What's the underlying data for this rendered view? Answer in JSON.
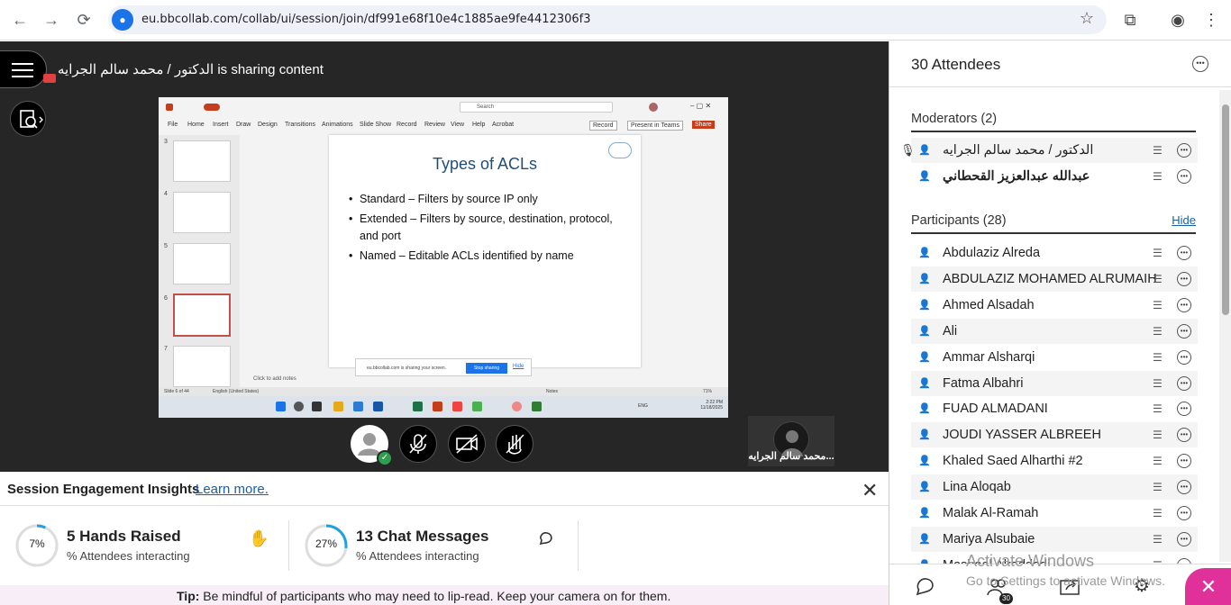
{
  "browser": {
    "url": "eu.bbcollab.com/collab/ui/session/join/df991e68f10e4c1885ae9fe4412306f3"
  },
  "stage": {
    "sharing_notice": "الدكتور / محمد سالم الجرايه is sharing content",
    "shared_slide": {
      "title": "Types of ACLs",
      "bullets": [
        "Standard – Filters by source IP only",
        "Extended – Filters by source, destination, protocol, and port",
        "Named – Editable ACLs identified by name"
      ],
      "search_placeholder": "Search",
      "ribbon_tabs": [
        "File",
        "Home",
        "Insert",
        "Draw",
        "Design",
        "Transitions",
        "Animations",
        "Slide Show",
        "Record",
        "Review",
        "View",
        "Help",
        "Acrobat"
      ],
      "record_label": "Record",
      "present_label": "Present in Teams",
      "share_label": "Share",
      "thumb_numbers": [
        "3",
        "4",
        "5",
        "6",
        "7"
      ],
      "notes_placeholder": "Click to add notes",
      "status_slide": "Slide 6 of 44",
      "status_lang": "English (United States)",
      "status_notes": "Notes",
      "zoom": "71%",
      "sharing_bar_text": "eu.bbcollab.com is sharing your screen.",
      "stop_sharing": "Stop sharing",
      "hide": "Hide",
      "clock_time": "2:22 PM",
      "clock_date": "11/18/2025",
      "lang_indicator": "ENG"
    },
    "video_tile_name": "محمد سالم الجرايه..."
  },
  "insights": {
    "title": "Session Engagement Insights",
    "learn_more": "Learn more.",
    "hands": {
      "percent_label": "7%",
      "percent": 7,
      "value": "5 Hands Raised",
      "sub": "% Attendees interacting"
    },
    "chat": {
      "percent_label": "27%",
      "percent": 27,
      "value": "13 Chat Messages",
      "sub": "% Attendees interacting"
    },
    "tip_label": "Tip:",
    "tip_text": "Be mindful of participants who may need to lip-read. Keep your camera on for them."
  },
  "attendees": {
    "title": "30 Attendees",
    "moderators_heading": "Moderators (2)",
    "moderators": [
      {
        "name": "الدكتور / محمد سالم الجرايه",
        "bold": false
      },
      {
        "name": "عبدالله عبدالعزيز القحطاني",
        "bold": true
      }
    ],
    "participants_heading": "Participants (28)",
    "hide_label": "Hide",
    "participants": [
      "Abdulaziz Alreda",
      "ABDULAZIZ MOHAMED ALRUMAIH",
      "Ahmed Alsadah",
      "Ali",
      "Ammar Alsharqi",
      "Fatma Albahri",
      "FUAD ALMADANI",
      "JOUDI YASSER ALBREEH",
      "Khaled Saed Alharthi #2",
      "Lina Aloqab",
      "Malak Al-Ramah",
      "Mariya Alsubaie",
      "Mashael Alraddadi"
    ],
    "badge": "30"
  },
  "watermark": {
    "line1": "Activate Windows",
    "line2": "Go to Settings to activate Windows."
  },
  "colors": {
    "stage_bg": "#262626",
    "accent_blue": "#1a5fa8",
    "close_pink": "#e0319b",
    "ring_blue": "#1ea1e0"
  }
}
